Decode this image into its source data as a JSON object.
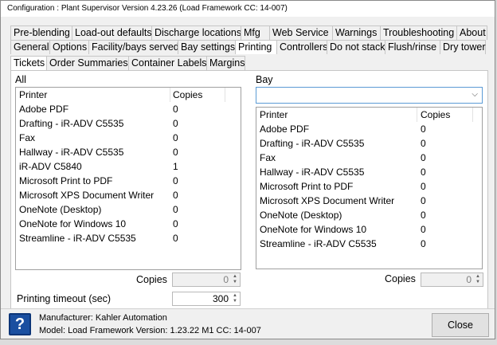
{
  "window": {
    "title": "Configuration : Plant Supervisor Version 4.23.26 (Load Framework CC: 14-007)"
  },
  "tabs_row1": [
    "Pre-blending",
    "Load-out defaults",
    "Discharge locations",
    "Mfg",
    "Web Service",
    "Warnings",
    "Troubleshooting",
    "About"
  ],
  "tabs_row2": [
    "General",
    "Options",
    "Facility/bays served",
    "Bay settings",
    "Printing",
    "Controllers",
    "Do not stack",
    "Flush/rinse",
    "Dry tower"
  ],
  "tabs_row3": [
    "Tickets",
    "Order Summaries",
    "Container Labels",
    "Margins"
  ],
  "all_group": {
    "label": "All",
    "col_printer": "Printer",
    "col_copies": "Copies",
    "rows": [
      {
        "printer": "Adobe PDF",
        "copies": "0"
      },
      {
        "printer": "Drafting - iR-ADV C5535",
        "copies": "0"
      },
      {
        "printer": "Fax",
        "copies": "0"
      },
      {
        "printer": "Hallway - iR-ADV C5535",
        "copies": "0"
      },
      {
        "printer": "iR-ADV C5840",
        "copies": "1"
      },
      {
        "printer": "Microsoft Print to PDF",
        "copies": "0"
      },
      {
        "printer": "Microsoft XPS Document Writer",
        "copies": "0"
      },
      {
        "printer": "OneNote (Desktop)",
        "copies": "0"
      },
      {
        "printer": "OneNote for Windows 10",
        "copies": "0"
      },
      {
        "printer": "Streamline - iR-ADV C5535",
        "copies": "0"
      }
    ],
    "copies_label": "Copies",
    "copies_value": "0"
  },
  "bay_group": {
    "label": "Bay",
    "combo_value": "",
    "col_printer": "Printer",
    "col_copies": "Copies",
    "rows": [
      {
        "printer": "Adobe PDF",
        "copies": "0"
      },
      {
        "printer": "Drafting - iR-ADV C5535",
        "copies": "0"
      },
      {
        "printer": "Fax",
        "copies": "0"
      },
      {
        "printer": "Hallway - iR-ADV C5535",
        "copies": "0"
      },
      {
        "printer": "Microsoft Print to PDF",
        "copies": "0"
      },
      {
        "printer": "Microsoft XPS Document Writer",
        "copies": "0"
      },
      {
        "printer": "OneNote (Desktop)",
        "copies": "0"
      },
      {
        "printer": "OneNote for Windows 10",
        "copies": "0"
      },
      {
        "printer": "Streamline - iR-ADV C5535",
        "copies": "0"
      }
    ],
    "copies_label": "Copies",
    "copies_value": "0"
  },
  "timeout": {
    "label": "Printing timeout (sec)",
    "value": "300"
  },
  "footer": {
    "manufacturer": "Manufacturer: Kahler Automation",
    "model": "Model: Load Framework Version: 1.23.22 M1 CC: 14-007",
    "help_glyph": "?",
    "close_label": "Close"
  },
  "icons": {
    "help": "help-icon",
    "dropdown": "chevron-down-icon",
    "spinner": "spinner-arrows-icon"
  },
  "colors": {
    "accent": "#5b9bd5",
    "help_icon_bg": "#1a4fa0",
    "window_bg": "#f0f0f0"
  }
}
